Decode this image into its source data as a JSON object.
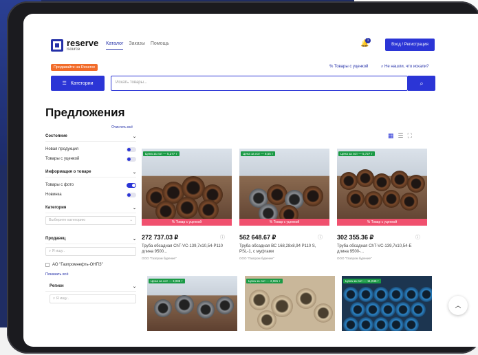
{
  "logo": {
    "name": "reserve",
    "sub": "isource"
  },
  "nav": {
    "items": [
      "Каталог",
      "Заказы",
      "Помощь"
    ]
  },
  "notifications": {
    "count": "1"
  },
  "header": {
    "login_label": "Вход / Регистрация"
  },
  "promo": {
    "label": "Продавайте на Reserve"
  },
  "links": {
    "discount": "Товары с уценкой",
    "not_found": "Не нашли, что искали?"
  },
  "search": {
    "categories_label": "Категории",
    "placeholder": "Искать товары..."
  },
  "page": {
    "title": "Предложения",
    "clear_all": "Очистить всё"
  },
  "filters": {
    "condition": {
      "title": "Состояние",
      "new": "Новая продукция",
      "discounted": "Товары с уценкой"
    },
    "info": {
      "title": "Информация о товаре",
      "with_photo": "Товары с фото",
      "novelty": "Новинка"
    },
    "category": {
      "title": "Категория",
      "placeholder": "Выберите категорию"
    },
    "seller": {
      "title": "Продавец",
      "search_placeholder": "Я ищу..",
      "option": "АО \"Газпромнефть-ОНПЗ\"",
      "show_all": "Показать всё"
    },
    "region": {
      "title": "Регион",
      "search_placeholder": "Я ищу.."
    }
  },
  "products": [
    {
      "price_tag": "Цена за лот — 5,277 т",
      "discount": "Товар с уценкой",
      "price": "272 737.03 ₽",
      "name": "Труба обсадная ChT-VC-139,7х10,54-P110 длина 9500...",
      "seller": "ООО \"Газпром бурение\""
    },
    {
      "price_tag": "Цена за лот — 8,55 т",
      "discount": "Товар с уценкой",
      "price": "562 648.67 ₽",
      "name": "Труба обсадная ВС 168,28х8,94 P110 S, PSL-1, с муфтами",
      "seller": "ООО \"Газпром бурение\""
    },
    {
      "price_tag": "Цена за лот — 5,727 т",
      "discount": "Товар с уценкой",
      "price": "302 355.36 ₽",
      "name": "Труба обсадная ChT-VC-139,7х10,54-E длина 9500-...",
      "seller": "ООО \"Газпром бурение\""
    },
    {
      "price_tag": "Цена за лот — 3,088 т"
    },
    {
      "price_tag": "Цена за лот — 2,081 т"
    },
    {
      "price_tag": "Цена за лот — 11,045 т"
    }
  ],
  "colors": {
    "primary": "#2b35d6",
    "promo": "#f26c2a",
    "discount": "#f0506e",
    "tag": "#1a9a45"
  }
}
